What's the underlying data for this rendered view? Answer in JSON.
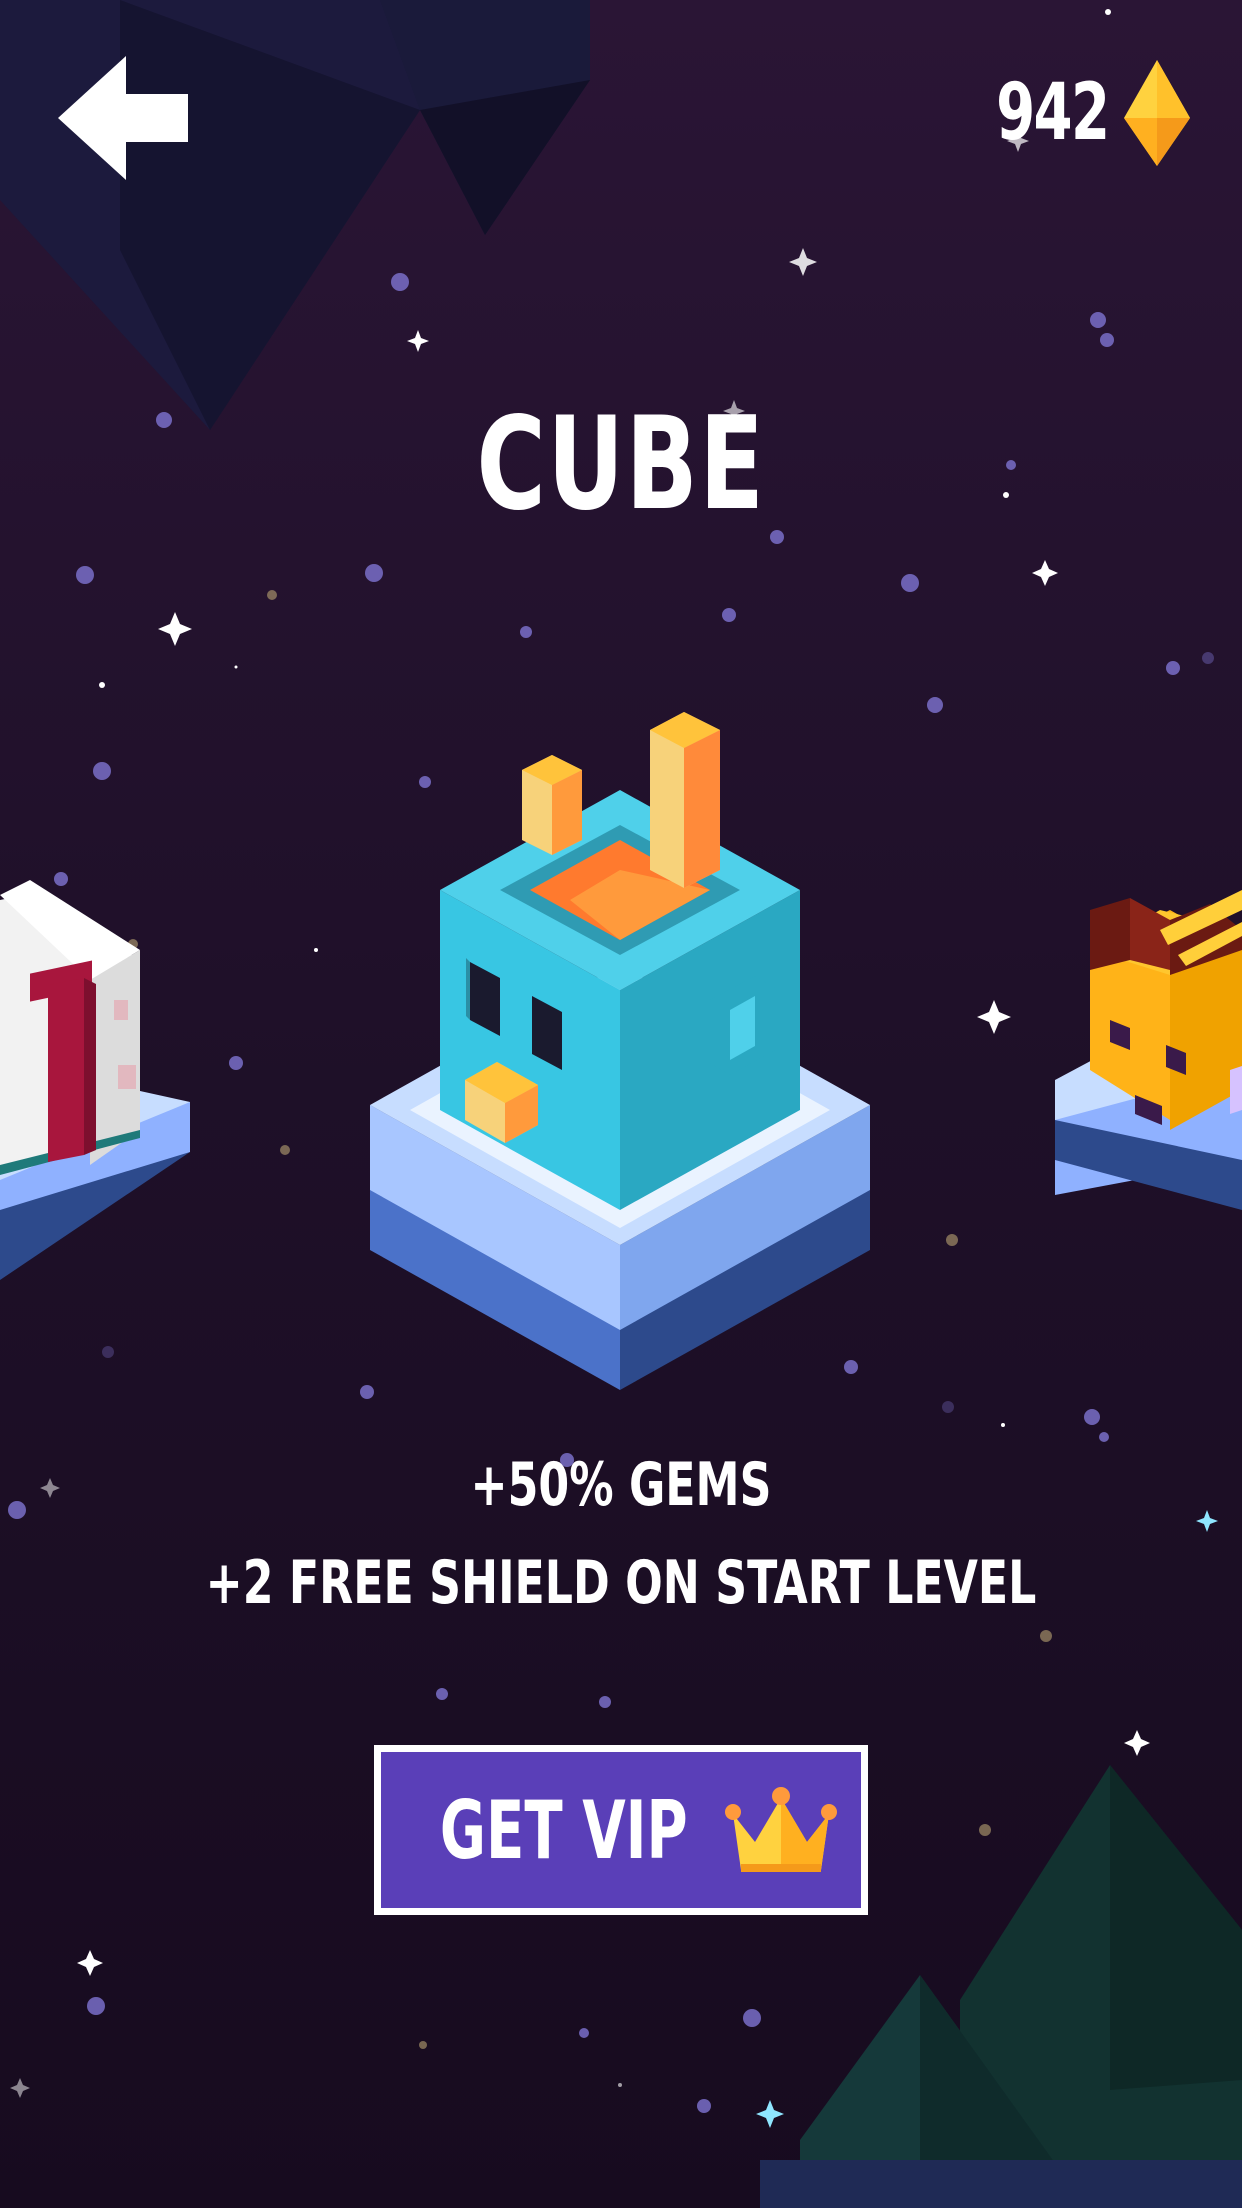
{
  "header": {
    "back_icon": "arrow-left-icon",
    "gem_count": "942",
    "gem_icon": "diamond-gem-icon",
    "gem_colors": [
      "#ffd23f",
      "#ffb020",
      "#f5a623"
    ]
  },
  "character": {
    "name": "CUBE",
    "perks": [
      "+50% GEMS",
      "+2 FREE SHIELD ON START LEVEL"
    ],
    "colors": {
      "body": "#38c6e3",
      "ears": "#f9b742",
      "pedestal": "#9ec3ff"
    }
  },
  "carousel": {
    "left_character": "white-cube-character",
    "center_character": "cyan-cube-character",
    "right_character": "yellow-striped-cube-character"
  },
  "vip_button": {
    "label": "GET VIP",
    "icon": "crown-icon",
    "bg_color": "#5a3fb8"
  }
}
